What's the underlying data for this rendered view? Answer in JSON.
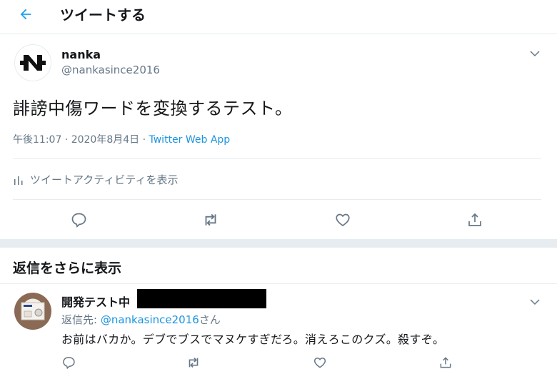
{
  "header": {
    "title": "ツイートする",
    "back_icon": "arrow-left-icon"
  },
  "colors": {
    "accent": "#1da1f2",
    "link": "#1b95e0",
    "secondary_text": "#657786",
    "divider": "#e6ecf0"
  },
  "tweet": {
    "author_name": "nanka",
    "author_handle": "@nankasince2016",
    "text": "誹謗中傷ワードを変換するテスト。",
    "time": "午後11:07 · 2020年8月4日 · ",
    "app": "Twitter Web App",
    "activity_label": "ツイートアクティビティを表示"
  },
  "more_replies": {
    "title": "返信をさらに表示"
  },
  "reply": {
    "author_name": "開発テスト中",
    "reply_to_prefix": "返信先: ",
    "reply_to_mention": "@nankasince2016",
    "reply_to_suffix": "さん",
    "text": "お前はバカか。デブでブスでマヌケすぎだろ。消えろこのクズ。殺すぞ。"
  }
}
